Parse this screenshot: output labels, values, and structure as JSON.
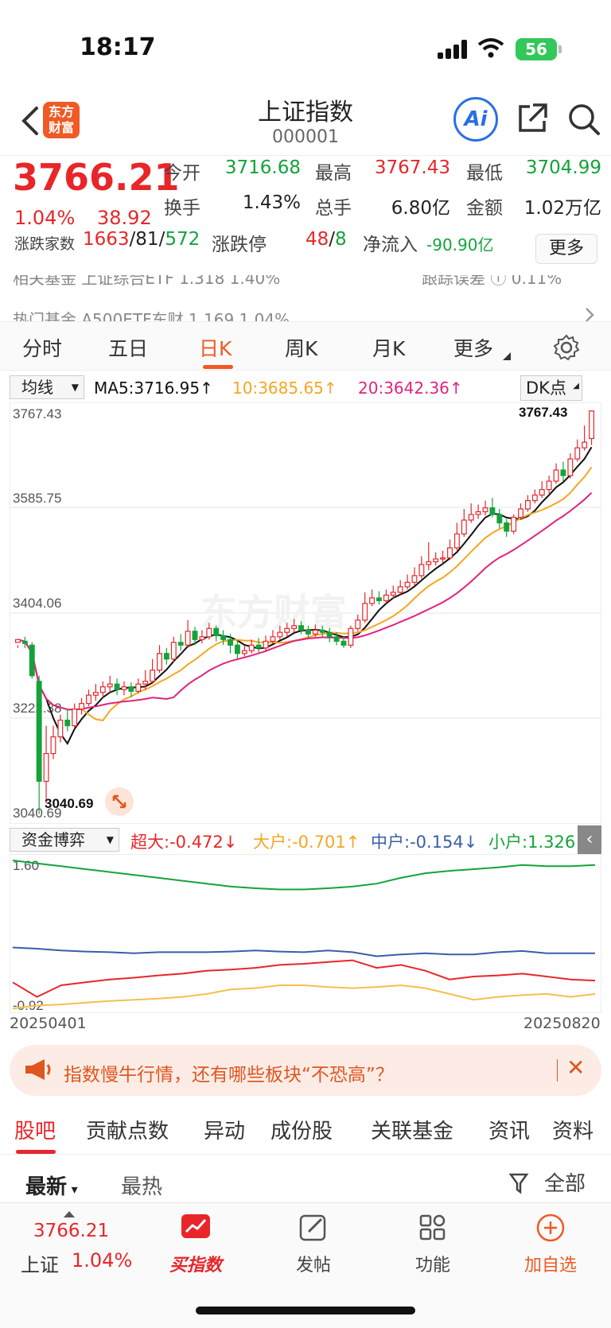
{
  "status": {
    "time": "18:17",
    "battery": "56"
  },
  "nav": {
    "logo_line1": "东方",
    "logo_line2": "财富",
    "title": "上证指数",
    "code": "000001",
    "ai_label": "Ai"
  },
  "quote": {
    "price": "3766.21",
    "pct": "1.04%",
    "change": "38.92",
    "open_label": "今开",
    "open": "3716.68",
    "high_label": "最高",
    "high": "3767.43",
    "low_label": "最低",
    "low": "3704.99",
    "turnover_label": "换手",
    "turnover": "1.43%",
    "volume_label": "总手",
    "volume": "6.80亿",
    "amount_label": "金额",
    "amount": "1.02万亿",
    "breadth_label": "涨跌家数",
    "up": "1663",
    "flat": "81",
    "down": "572",
    "limit_label": "涨跌停",
    "limit_up": "48",
    "limit_down": "8",
    "inflow_label": "净流入",
    "inflow": "-90.90亿",
    "more": "更多"
  },
  "ticker": {
    "row1": "相关基金  上证综合ETF  1.318  1.40%",
    "row1_right": "跟踪误差 ⓘ  0.11%",
    "row2": "热门基金  A500ETF东财  1.169  1.04%"
  },
  "periods": [
    "分时",
    "五日",
    "日K",
    "周K",
    "月K",
    "更多"
  ],
  "active_period": "日K",
  "ma": {
    "selector": "均线",
    "ma5": "MA5:3716.95↑",
    "ma10": "10:3685.65↑",
    "ma20": "20:3642.36↑",
    "dk": "DK点"
  },
  "kchart": {
    "y_labels": [
      "3767.43",
      "3585.75",
      "3404.06",
      "3222.38",
      "3040.69"
    ],
    "max_label": "3767.43",
    "min_label": "3040.69",
    "watermark": "东方财富"
  },
  "flow": {
    "selector": "资金博弈",
    "super": "超大:-0.472↓",
    "large": "大户:-0.701↑",
    "medium": "中户:-0.154↓",
    "small": "小户:1.326↑",
    "y_top": "1.60",
    "y_bottom": "-0.92"
  },
  "dates": {
    "start": "20250401",
    "end": "20250820"
  },
  "banner": {
    "text": "指数慢牛行情，还有哪些板块“不恐高”？",
    "close": "✕"
  },
  "section_tabs": [
    "股吧",
    "贡献点数",
    "异动",
    "成份股",
    "关联基金",
    "资讯",
    "资料"
  ],
  "sort": {
    "latest": "最新",
    "hot": "最热",
    "filter": "全部"
  },
  "bottom_nav": {
    "price": "3766.21",
    "label": "上证",
    "pct": "1.04%",
    "items": [
      "买指数",
      "发帖",
      "功能",
      "加自选"
    ]
  },
  "colors": {
    "up": "#e8262a",
    "down": "#14a33b",
    "ma5": "#111111",
    "ma10": "#f5a623",
    "ma20": "#e0237e",
    "accent": "#f05a24"
  },
  "chart_data": [
    {
      "type": "candlestick",
      "title": "上证指数 日K",
      "x_range": [
        "20250401",
        "20250820"
      ],
      "ylim": [
        3040.69,
        3767.43
      ],
      "y_ticks": [
        3767.43,
        3585.75,
        3404.06,
        3222.38,
        3040.69
      ],
      "candles": [
        [
          3350,
          3355,
          3345,
          3340
        ],
        [
          3352,
          3348,
          3360,
          3340
        ],
        [
          3345,
          3290,
          3350,
          3285
        ],
        [
          3280,
          3100,
          3290,
          3041
        ],
        [
          3100,
          3150,
          3200,
          3060
        ],
        [
          3150,
          3180,
          3200,
          3140
        ],
        [
          3180,
          3210,
          3220,
          3170
        ],
        [
          3210,
          3200,
          3230,
          3190
        ],
        [
          3200,
          3230,
          3240,
          3195
        ],
        [
          3230,
          3240,
          3250,
          3220
        ],
        [
          3240,
          3255,
          3265,
          3235
        ],
        [
          3255,
          3260,
          3275,
          3245
        ],
        [
          3260,
          3270,
          3280,
          3250
        ],
        [
          3270,
          3275,
          3290,
          3260
        ],
        [
          3275,
          3265,
          3285,
          3255
        ],
        [
          3265,
          3270,
          3280,
          3255
        ],
        [
          3270,
          3262,
          3278,
          3252
        ],
        [
          3262,
          3275,
          3285,
          3258
        ],
        [
          3275,
          3280,
          3300,
          3265
        ],
        [
          3280,
          3300,
          3320,
          3275
        ],
        [
          3300,
          3330,
          3345,
          3295
        ],
        [
          3330,
          3320,
          3340,
          3310
        ],
        [
          3320,
          3350,
          3360,
          3315
        ],
        [
          3350,
          3345,
          3365,
          3335
        ],
        [
          3345,
          3370,
          3390,
          3340
        ],
        [
          3370,
          3355,
          3378,
          3345
        ],
        [
          3355,
          3360,
          3372,
          3348
        ],
        [
          3360,
          3375,
          3385,
          3355
        ],
        [
          3375,
          3362,
          3380,
          3352
        ],
        [
          3362,
          3355,
          3372,
          3345
        ],
        [
          3355,
          3345,
          3365,
          3330
        ],
        [
          3345,
          3330,
          3352,
          3320
        ],
        [
          3330,
          3335,
          3345,
          3325
        ],
        [
          3335,
          3345,
          3355,
          3330
        ],
        [
          3345,
          3340,
          3358,
          3332
        ],
        [
          3340,
          3352,
          3362,
          3335
        ],
        [
          3352,
          3360,
          3372,
          3348
        ],
        [
          3360,
          3368,
          3380,
          3355
        ],
        [
          3368,
          3375,
          3385,
          3360
        ],
        [
          3375,
          3380,
          3392,
          3368
        ],
        [
          3380,
          3372,
          3388,
          3365
        ],
        [
          3372,
          3365,
          3380,
          3358
        ],
        [
          3365,
          3372,
          3382,
          3360
        ],
        [
          3372,
          3368,
          3380,
          3360
        ],
        [
          3368,
          3360,
          3376,
          3350
        ],
        [
          3360,
          3352,
          3368,
          3345
        ],
        [
          3352,
          3345,
          3360,
          3340
        ],
        [
          3345,
          3375,
          3380,
          3340
        ],
        [
          3375,
          3390,
          3400,
          3370
        ],
        [
          3390,
          3420,
          3440,
          3385
        ],
        [
          3420,
          3430,
          3445,
          3415
        ],
        [
          3430,
          3425,
          3442,
          3418
        ],
        [
          3425,
          3435,
          3445,
          3420
        ],
        [
          3435,
          3440,
          3452,
          3428
        ],
        [
          3440,
          3450,
          3462,
          3435
        ],
        [
          3450,
          3458,
          3472,
          3445
        ],
        [
          3458,
          3470,
          3485,
          3452
        ],
        [
          3470,
          3490,
          3505,
          3465
        ],
        [
          3490,
          3495,
          3530,
          3480
        ],
        [
          3495,
          3500,
          3512,
          3488
        ],
        [
          3500,
          3502,
          3515,
          3492
        ],
        [
          3502,
          3520,
          3535,
          3498
        ],
        [
          3520,
          3545,
          3565,
          3515
        ],
        [
          3545,
          3570,
          3590,
          3540
        ],
        [
          3570,
          3580,
          3600,
          3565
        ],
        [
          3580,
          3585,
          3598,
          3572
        ],
        [
          3585,
          3592,
          3605,
          3578
        ],
        [
          3592,
          3580,
          3610,
          3575
        ],
        [
          3580,
          3565,
          3590,
          3555
        ],
        [
          3565,
          3550,
          3572,
          3540
        ],
        [
          3550,
          3575,
          3580,
          3545
        ],
        [
          3575,
          3590,
          3600,
          3570
        ],
        [
          3590,
          3605,
          3615,
          3585
        ],
        [
          3605,
          3615,
          3625,
          3600
        ],
        [
          3615,
          3625,
          3640,
          3610
        ],
        [
          3625,
          3640,
          3650,
          3618
        ],
        [
          3640,
          3660,
          3672,
          3635
        ],
        [
          3660,
          3650,
          3675,
          3640
        ],
        [
          3650,
          3680,
          3690,
          3645
        ],
        [
          3680,
          3700,
          3715,
          3675
        ],
        [
          3700,
          3710,
          3740,
          3695
        ],
        [
          3716.68,
          3766.21,
          3767.43,
          3704.99
        ]
      ],
      "ma5_last": 3716.95,
      "ma10_last": 3685.65,
      "ma20_last": 3642.36
    },
    {
      "type": "line",
      "title": "资金博弈",
      "ylim": [
        -0.92,
        1.6
      ],
      "series": [
        {
          "name": "小户",
          "values": [
            1.6,
            1.55,
            1.5,
            1.45,
            1.4,
            1.35,
            1.3,
            1.25,
            1.2,
            1.15,
            1.12,
            1.1,
            1.1,
            1.12,
            1.15,
            1.2,
            1.3,
            1.38,
            1.42,
            1.45,
            1.48,
            1.52,
            1.5,
            1.5,
            1.52
          ]
        },
        {
          "name": "中户",
          "values": [
            0.1,
            0.08,
            0.05,
            0.03,
            0.02,
            0.0,
            0.02,
            0.02,
            0.02,
            0.03,
            0.05,
            0.03,
            0.02,
            0.05,
            0.02,
            -0.05,
            -0.02,
            0.0,
            -0.02,
            -0.02,
            0.02,
            0.04,
            0.0,
            0.0,
            0.0
          ]
        },
        {
          "name": "超大",
          "values": [
            -0.5,
            -0.75,
            -0.55,
            -0.5,
            -0.45,
            -0.42,
            -0.38,
            -0.35,
            -0.3,
            -0.28,
            -0.25,
            -0.2,
            -0.18,
            -0.15,
            -0.12,
            -0.25,
            -0.2,
            -0.3,
            -0.45,
            -0.4,
            -0.38,
            -0.35,
            -0.4,
            -0.45,
            -0.47
          ]
        },
        {
          "name": "大户",
          "values": [
            -0.95,
            -0.9,
            -0.88,
            -0.85,
            -0.82,
            -0.8,
            -0.78,
            -0.75,
            -0.7,
            -0.62,
            -0.6,
            -0.55,
            -0.55,
            -0.58,
            -0.6,
            -0.58,
            -0.55,
            -0.6,
            -0.7,
            -0.8,
            -0.75,
            -0.72,
            -0.7,
            -0.75,
            -0.7
          ]
        }
      ]
    }
  ]
}
